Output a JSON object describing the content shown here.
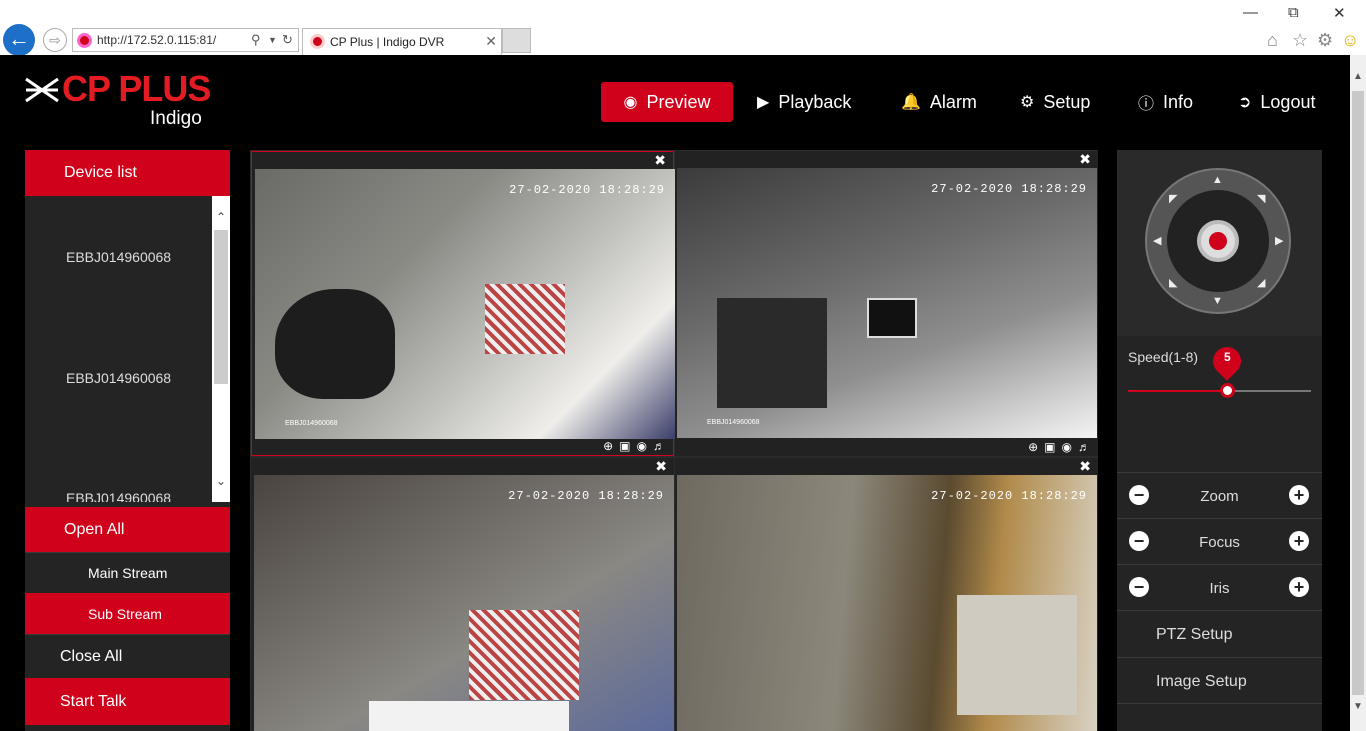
{
  "browser": {
    "url": "http://172.52.0.115:81/",
    "tab_title": "CP Plus | Indigo DVR"
  },
  "app": {
    "brand": "CP PLUS",
    "subbrand": "Indigo",
    "accent_color": "#d0021b"
  },
  "nav": [
    {
      "label": "Preview",
      "icon": "eye-icon",
      "active": true
    },
    {
      "label": "Playback",
      "icon": "play-circle-icon"
    },
    {
      "label": "Alarm",
      "icon": "bell-icon"
    },
    {
      "label": "Setup",
      "icon": "gear-icon"
    },
    {
      "label": "Info",
      "icon": "info-icon"
    },
    {
      "label": "Logout",
      "icon": "logout-icon"
    }
  ],
  "left_panel": {
    "device_list_title": "Device list",
    "devices": [
      "EBBJ014960068",
      "EBBJ014960068",
      "EBBJ014960068"
    ],
    "open_all": "Open All",
    "main_stream": "Main Stream",
    "sub_stream": "Sub Stream",
    "close_all": "Close All",
    "start_talk": "Start Talk"
  },
  "cameras": [
    {
      "timestamp": "27-02-2020 18:28:29",
      "label": "EBBJ014960068",
      "selected": true,
      "show_controls": true
    },
    {
      "timestamp": "27-02-2020 18:28:29",
      "label": "EBBJ014960068",
      "selected": false,
      "show_controls": true
    },
    {
      "timestamp": "27-02-2020 18:28:29",
      "label": "",
      "selected": false,
      "show_controls": false
    },
    {
      "timestamp": "27-02-2020 18:28:29",
      "label": "",
      "selected": false,
      "show_controls": false
    }
  ],
  "ptz": {
    "speed_label": "Speed(1-8)",
    "speed_value": "5",
    "speed_min": 1,
    "speed_max": 8,
    "zoom": "Zoom",
    "focus": "Focus",
    "iris": "Iris",
    "ptz_setup": "PTZ Setup",
    "image_setup": "Image Setup"
  }
}
